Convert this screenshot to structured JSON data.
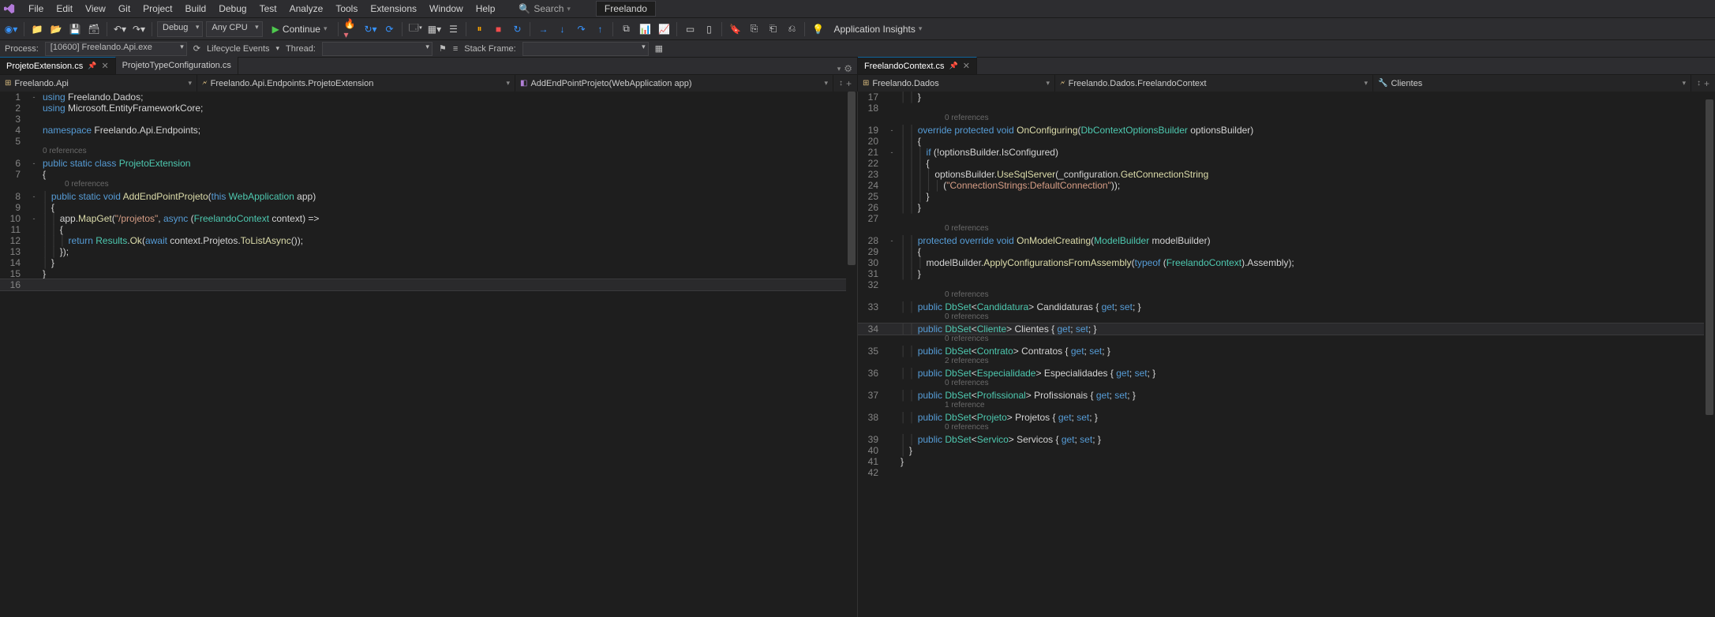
{
  "menu": {
    "items": [
      "File",
      "Edit",
      "View",
      "Git",
      "Project",
      "Build",
      "Debug",
      "Test",
      "Analyze",
      "Tools",
      "Extensions",
      "Window",
      "Help"
    ],
    "search": "Search",
    "solution": "Freelando"
  },
  "toolbar": {
    "config": "Debug",
    "platform": "Any CPU",
    "continue": "Continue",
    "insights": "Application Insights"
  },
  "debugbar": {
    "process_label": "Process:",
    "process": "[10600] Freelando.Api.exe",
    "lifecycle": "Lifecycle Events",
    "thread": "Thread:",
    "stack": "Stack Frame:"
  },
  "tabs": {
    "left": [
      {
        "name": "ProjetoExtension.cs",
        "active": true,
        "pinned": true
      },
      {
        "name": "ProjetoTypeConfiguration.cs",
        "active": false
      }
    ],
    "right": [
      {
        "name": "FreelandoContext.cs",
        "active": true,
        "pinned": true
      }
    ]
  },
  "nav": {
    "left": {
      "a": "Freelando.Api",
      "b": "Freelando.Api.Endpoints.ProjetoExtension",
      "c": "AddEndPointProjeto(WebApplication app)"
    },
    "right": {
      "a": "Freelando.Dados",
      "b": "Freelando.Dados.FreelandoContext",
      "c": "Clientes"
    }
  },
  "left_editor": {
    "lines": [
      {
        "n": 1,
        "fold": "-",
        "seg": [
          [
            "kw",
            "using"
          ],
          [
            "pln",
            " Freelando.Dados;"
          ]
        ]
      },
      {
        "n": 2,
        "seg": [
          [
            "kw",
            "using"
          ],
          [
            "pln",
            " Microsoft.EntityFrameworkCore;"
          ]
        ]
      },
      {
        "n": 3,
        "seg": [
          [
            "pln",
            ""
          ]
        ]
      },
      {
        "n": 4,
        "seg": [
          [
            "kw",
            "namespace"
          ],
          [
            "pln",
            " Freelando.Api.Endpoints;"
          ]
        ]
      },
      {
        "n": 5,
        "seg": [
          [
            "pln",
            ""
          ]
        ]
      },
      {
        "lens": "0 references",
        "indent": 0
      },
      {
        "n": 6,
        "fold": "-",
        "seg": [
          [
            "kw",
            "public static class"
          ],
          [
            "pln",
            " "
          ],
          [
            "type",
            "ProjetoExtension"
          ]
        ]
      },
      {
        "n": 7,
        "seg": [
          [
            "pln",
            "{"
          ]
        ]
      },
      {
        "lens": "0 references",
        "indent": 4
      },
      {
        "n": 8,
        "fold": "-",
        "seg": [
          [
            "pln",
            "    "
          ],
          [
            "kw",
            "public static void"
          ],
          [
            "pln",
            " "
          ],
          [
            "mtd",
            "AddEndPointProjeto"
          ],
          [
            "pln",
            "("
          ],
          [
            "kw",
            "this"
          ],
          [
            "pln",
            " "
          ],
          [
            "type",
            "WebApplication"
          ],
          [
            "pln",
            " app)"
          ]
        ]
      },
      {
        "n": 9,
        "seg": [
          [
            "pln",
            "    {"
          ]
        ]
      },
      {
        "n": 10,
        "fold": "-",
        "seg": [
          [
            "pln",
            "        app."
          ],
          [
            "mtd",
            "MapGet"
          ],
          [
            "pln",
            "("
          ],
          [
            "str",
            "\"/projetos\""
          ],
          [
            "pln",
            ", "
          ],
          [
            "kw",
            "async"
          ],
          [
            "pln",
            " ("
          ],
          [
            "type",
            "FreelandoContext"
          ],
          [
            "pln",
            " context) =>"
          ]
        ]
      },
      {
        "n": 11,
        "seg": [
          [
            "pln",
            "        {"
          ]
        ]
      },
      {
        "n": 12,
        "seg": [
          [
            "pln",
            "            "
          ],
          [
            "kw",
            "return"
          ],
          [
            "pln",
            " "
          ],
          [
            "type",
            "Results"
          ],
          [
            "pln",
            "."
          ],
          [
            "mtd",
            "Ok"
          ],
          [
            "pln",
            "("
          ],
          [
            "kw",
            "await"
          ],
          [
            "pln",
            " context.Projetos."
          ],
          [
            "mtd",
            "ToListAsync"
          ],
          [
            "pln",
            "());"
          ]
        ]
      },
      {
        "n": 13,
        "seg": [
          [
            "pln",
            "        });"
          ]
        ]
      },
      {
        "n": 14,
        "seg": [
          [
            "pln",
            "    }"
          ]
        ]
      },
      {
        "n": 15,
        "seg": [
          [
            "pln",
            "}"
          ]
        ]
      },
      {
        "n": 16,
        "cursor": true,
        "seg": [
          [
            "pln",
            ""
          ]
        ]
      }
    ]
  },
  "right_editor": {
    "lines": [
      {
        "n": 17,
        "seg": [
          [
            "pln",
            "        }"
          ]
        ]
      },
      {
        "n": 18,
        "seg": [
          [
            "pln",
            ""
          ]
        ]
      },
      {
        "lens": "0 references",
        "indent": 8
      },
      {
        "n": 19,
        "fold": "-",
        "seg": [
          [
            "pln",
            "        "
          ],
          [
            "kw",
            "override protected void"
          ],
          [
            "pln",
            " "
          ],
          [
            "mtd",
            "OnConfiguring"
          ],
          [
            "pln",
            "("
          ],
          [
            "type",
            "DbContextOptionsBuilder"
          ],
          [
            "pln",
            " optionsBuilder)"
          ]
        ]
      },
      {
        "n": 20,
        "seg": [
          [
            "pln",
            "        {"
          ]
        ]
      },
      {
        "n": 21,
        "fold": "-",
        "seg": [
          [
            "pln",
            "            "
          ],
          [
            "kw",
            "if"
          ],
          [
            "pln",
            " (!optionsBuilder.IsConfigured)"
          ]
        ]
      },
      {
        "n": 22,
        "seg": [
          [
            "pln",
            "            {"
          ]
        ]
      },
      {
        "n": 23,
        "seg": [
          [
            "pln",
            "                optionsBuilder."
          ],
          [
            "mtd",
            "UseSqlServer"
          ],
          [
            "pln",
            "(_configuration."
          ],
          [
            "mtd",
            "GetConnectionString"
          ]
        ]
      },
      {
        "n": 24,
        "seg": [
          [
            "pln",
            "                    ("
          ],
          [
            "str",
            "\"ConnectionStrings:DefaultConnection\""
          ],
          [
            "pln",
            "));"
          ]
        ]
      },
      {
        "n": 25,
        "seg": [
          [
            "pln",
            "            }"
          ]
        ]
      },
      {
        "n": 26,
        "seg": [
          [
            "pln",
            "        }"
          ]
        ]
      },
      {
        "n": 27,
        "seg": [
          [
            "pln",
            ""
          ]
        ]
      },
      {
        "lens": "0 references",
        "indent": 8
      },
      {
        "n": 28,
        "fold": "-",
        "seg": [
          [
            "pln",
            "        "
          ],
          [
            "kw",
            "protected override void"
          ],
          [
            "pln",
            " "
          ],
          [
            "mtd",
            "OnModelCreating"
          ],
          [
            "pln",
            "("
          ],
          [
            "type",
            "ModelBuilder"
          ],
          [
            "pln",
            " modelBuilder)"
          ]
        ]
      },
      {
        "n": 29,
        "seg": [
          [
            "pln",
            "        {"
          ]
        ]
      },
      {
        "n": 30,
        "seg": [
          [
            "pln",
            "            modelBuilder."
          ],
          [
            "mtd",
            "ApplyConfigurationsFromAssembly"
          ],
          [
            "pln",
            "("
          ],
          [
            "kw",
            "typeof"
          ],
          [
            "pln",
            " ("
          ],
          [
            "type",
            "FreelandoContext"
          ],
          [
            "pln",
            ").Assembly);"
          ]
        ]
      },
      {
        "n": 31,
        "seg": [
          [
            "pln",
            "        }"
          ]
        ]
      },
      {
        "n": 32,
        "seg": [
          [
            "pln",
            ""
          ]
        ]
      },
      {
        "lens": "0 references",
        "indent": 8
      },
      {
        "n": 33,
        "seg": [
          [
            "pln",
            "        "
          ],
          [
            "kw",
            "public"
          ],
          [
            "pln",
            " "
          ],
          [
            "type",
            "DbSet"
          ],
          [
            "pln",
            "<"
          ],
          [
            "type",
            "Candidatura"
          ],
          [
            "pln",
            "> Candidaturas { "
          ],
          [
            "kw",
            "get"
          ],
          [
            "pln",
            "; "
          ],
          [
            "kw",
            "set"
          ],
          [
            "pln",
            "; }"
          ]
        ]
      },
      {
        "lens": "0 references",
        "indent": 8
      },
      {
        "n": 34,
        "cursor": true,
        "seg": [
          [
            "pln",
            "        "
          ],
          [
            "kw",
            "public"
          ],
          [
            "pln",
            " "
          ],
          [
            "type",
            "DbSet"
          ],
          [
            "pln",
            "<"
          ],
          [
            "type",
            "Cliente"
          ],
          [
            "pln",
            "> Clientes { "
          ],
          [
            "kw",
            "get"
          ],
          [
            "pln",
            "; "
          ],
          [
            "kw",
            "set"
          ],
          [
            "pln",
            "; }"
          ]
        ]
      },
      {
        "lens": "0 references",
        "indent": 8
      },
      {
        "n": 35,
        "seg": [
          [
            "pln",
            "        "
          ],
          [
            "kw",
            "public"
          ],
          [
            "pln",
            " "
          ],
          [
            "type",
            "DbSet"
          ],
          [
            "pln",
            "<"
          ],
          [
            "type",
            "Contrato"
          ],
          [
            "pln",
            "> Contratos { "
          ],
          [
            "kw",
            "get"
          ],
          [
            "pln",
            "; "
          ],
          [
            "kw",
            "set"
          ],
          [
            "pln",
            "; }"
          ]
        ]
      },
      {
        "lens": "2 references",
        "indent": 8
      },
      {
        "n": 36,
        "seg": [
          [
            "pln",
            "        "
          ],
          [
            "kw",
            "public"
          ],
          [
            "pln",
            " "
          ],
          [
            "type",
            "DbSet"
          ],
          [
            "pln",
            "<"
          ],
          [
            "type",
            "Especialidade"
          ],
          [
            "pln",
            "> Especialidades { "
          ],
          [
            "kw",
            "get"
          ],
          [
            "pln",
            "; "
          ],
          [
            "kw",
            "set"
          ],
          [
            "pln",
            "; }"
          ]
        ]
      },
      {
        "lens": "0 references",
        "indent": 8
      },
      {
        "n": 37,
        "seg": [
          [
            "pln",
            "        "
          ],
          [
            "kw",
            "public"
          ],
          [
            "pln",
            " "
          ],
          [
            "type",
            "DbSet"
          ],
          [
            "pln",
            "<"
          ],
          [
            "type",
            "Profissional"
          ],
          [
            "pln",
            "> Profissionais { "
          ],
          [
            "kw",
            "get"
          ],
          [
            "pln",
            "; "
          ],
          [
            "kw",
            "set"
          ],
          [
            "pln",
            "; }"
          ]
        ]
      },
      {
        "lens": "1 reference",
        "indent": 8
      },
      {
        "n": 38,
        "seg": [
          [
            "pln",
            "        "
          ],
          [
            "kw",
            "public"
          ],
          [
            "pln",
            " "
          ],
          [
            "type",
            "DbSet"
          ],
          [
            "pln",
            "<"
          ],
          [
            "type",
            "Projeto"
          ],
          [
            "pln",
            "> Projetos { "
          ],
          [
            "kw",
            "get"
          ],
          [
            "pln",
            "; "
          ],
          [
            "kw",
            "set"
          ],
          [
            "pln",
            "; }"
          ]
        ]
      },
      {
        "lens": "0 references",
        "indent": 8
      },
      {
        "n": 39,
        "seg": [
          [
            "pln",
            "        "
          ],
          [
            "kw",
            "public"
          ],
          [
            "pln",
            " "
          ],
          [
            "type",
            "DbSet"
          ],
          [
            "pln",
            "<"
          ],
          [
            "type",
            "Servico"
          ],
          [
            "pln",
            "> Servicos { "
          ],
          [
            "kw",
            "get"
          ],
          [
            "pln",
            "; "
          ],
          [
            "kw",
            "set"
          ],
          [
            "pln",
            "; }"
          ]
        ]
      },
      {
        "n": 40,
        "seg": [
          [
            "pln",
            "    }"
          ]
        ]
      },
      {
        "n": 41,
        "seg": [
          [
            "pln",
            "}"
          ]
        ]
      },
      {
        "n": 42,
        "seg": [
          [
            "pln",
            ""
          ]
        ]
      }
    ]
  }
}
